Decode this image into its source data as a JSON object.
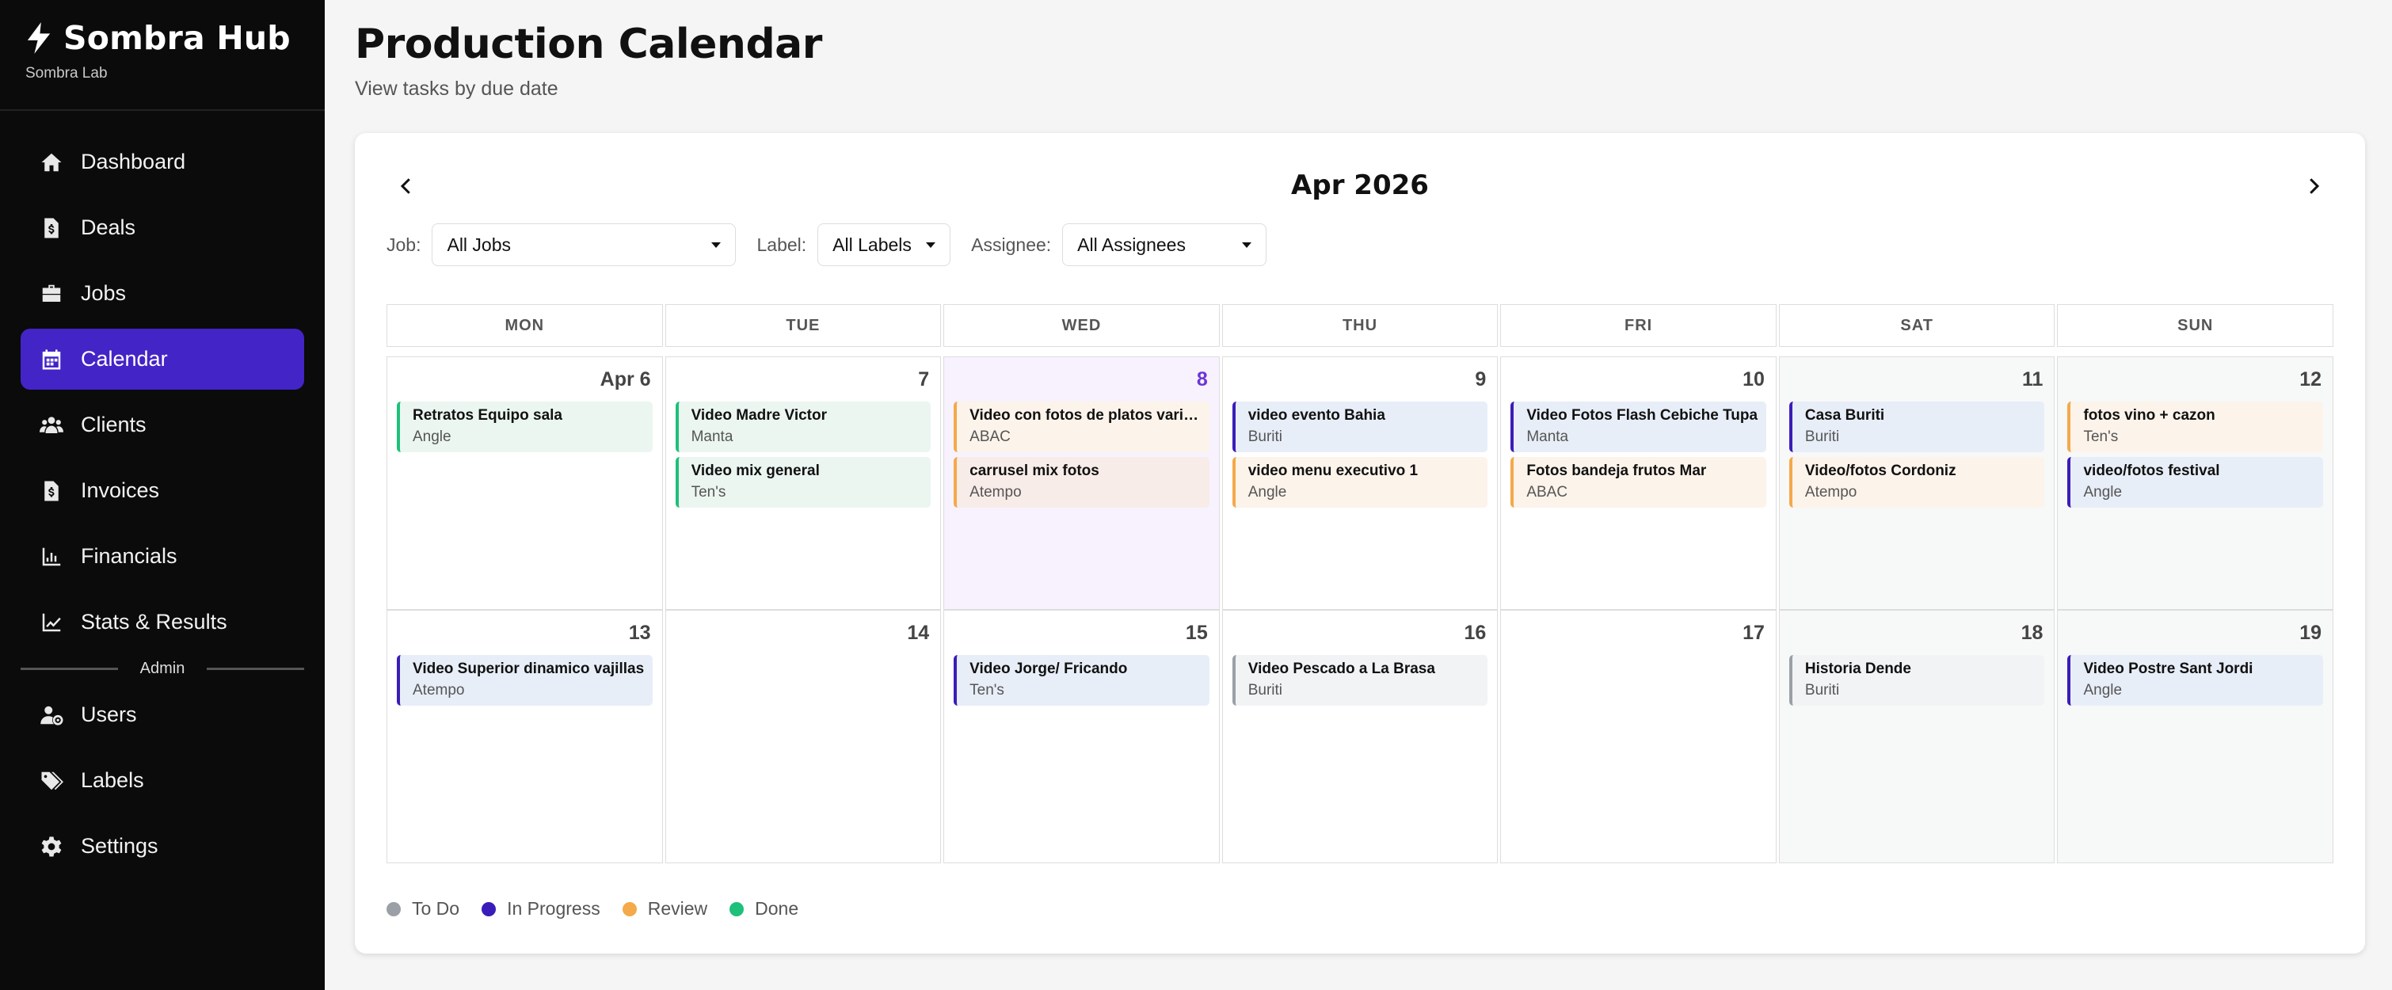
{
  "brand": {
    "title": "Sombra Hub",
    "subtitle": "Sombra Lab"
  },
  "nav": [
    {
      "label": "Dashboard",
      "icon": "home-icon"
    },
    {
      "label": "Deals",
      "icon": "dollar-file-icon"
    },
    {
      "label": "Jobs",
      "icon": "briefcase-icon"
    },
    {
      "label": "Calendar",
      "icon": "calendar-icon",
      "active": true
    },
    {
      "label": "Clients",
      "icon": "users-icon"
    },
    {
      "label": "Invoices",
      "icon": "invoice-icon"
    },
    {
      "label": "Financials",
      "icon": "bar-chart-icon"
    },
    {
      "label": "Stats & Results",
      "icon": "line-chart-icon"
    }
  ],
  "admin_label": "Admin",
  "admin_nav": [
    {
      "label": "Users",
      "icon": "user-cog-icon"
    },
    {
      "label": "Labels",
      "icon": "tags-icon"
    },
    {
      "label": "Settings",
      "icon": "gear-icon"
    }
  ],
  "page": {
    "title": "Production Calendar",
    "subtitle": "View tasks by due date"
  },
  "calendar": {
    "month": "Apr 2026",
    "filters": {
      "job_label": "Job:",
      "job_value": "All Jobs",
      "label_label": "Label:",
      "label_value": "All Labels",
      "assignee_label": "Assignee:",
      "assignee_value": "All Assignees"
    },
    "weekdays": [
      "MON",
      "TUE",
      "WED",
      "THU",
      "FRI",
      "SAT",
      "SUN"
    ],
    "weeks": [
      [
        {
          "num": "Apr 6",
          "events": [
            {
              "title": "Retratos Equipo sala",
              "client": "Angle",
              "status": "done"
            }
          ]
        },
        {
          "num": "7",
          "events": [
            {
              "title": "Video Madre Victor",
              "client": "Manta",
              "status": "done"
            },
            {
              "title": "Video mix general",
              "client": "Ten's",
              "status": "done"
            }
          ]
        },
        {
          "num": "8",
          "today": true,
          "events": [
            {
              "title": "Video con fotos de platos variad…",
              "client": "ABAC",
              "status": "review"
            },
            {
              "title": "carrusel mix fotos",
              "client": "Atempo",
              "status": "review2"
            }
          ]
        },
        {
          "num": "9",
          "events": [
            {
              "title": "video evento Bahia",
              "client": "Buriti",
              "status": "prog"
            },
            {
              "title": "video menu executivo 1",
              "client": "Angle",
              "status": "review"
            }
          ]
        },
        {
          "num": "10",
          "events": [
            {
              "title": "Video Fotos Flash Cebiche Tupa",
              "client": "Manta",
              "status": "prog"
            },
            {
              "title": "Fotos bandeja frutos Mar",
              "client": "ABAC",
              "status": "review"
            }
          ]
        },
        {
          "num": "11",
          "weekend": true,
          "events": [
            {
              "title": "Casa Buriti",
              "client": "Buriti",
              "status": "prog"
            },
            {
              "title": "Video/fotos Cordoniz",
              "client": "Atempo",
              "status": "review"
            }
          ]
        },
        {
          "num": "12",
          "weekend": true,
          "events": [
            {
              "title": "fotos vino + cazon",
              "client": "Ten's",
              "status": "review"
            },
            {
              "title": "video/fotos festival",
              "client": "Angle",
              "status": "prog"
            }
          ]
        }
      ],
      [
        {
          "num": "13",
          "events": [
            {
              "title": "Video Superior dinamico vajillas",
              "client": "Atempo",
              "status": "prog"
            }
          ]
        },
        {
          "num": "14",
          "events": []
        },
        {
          "num": "15",
          "events": [
            {
              "title": "Video Jorge/ Fricando",
              "client": "Ten's",
              "status": "prog"
            }
          ]
        },
        {
          "num": "16",
          "events": [
            {
              "title": "Video Pescado a La Brasa",
              "client": "Buriti",
              "status": "todo"
            }
          ]
        },
        {
          "num": "17",
          "events": []
        },
        {
          "num": "18",
          "weekend": true,
          "events": [
            {
              "title": "Historia Dende",
              "client": "Buriti",
              "status": "todo"
            }
          ]
        },
        {
          "num": "19",
          "weekend": true,
          "events": [
            {
              "title": "Video Postre Sant Jordi",
              "client": "Angle",
              "status": "prog"
            }
          ]
        }
      ]
    ],
    "legend": [
      {
        "label": "To Do",
        "color": "#9aa0a6"
      },
      {
        "label": "In Progress",
        "color": "#3a1db8"
      },
      {
        "label": "Review",
        "color": "#f4a94a"
      },
      {
        "label": "Done",
        "color": "#1ec07a"
      }
    ]
  }
}
